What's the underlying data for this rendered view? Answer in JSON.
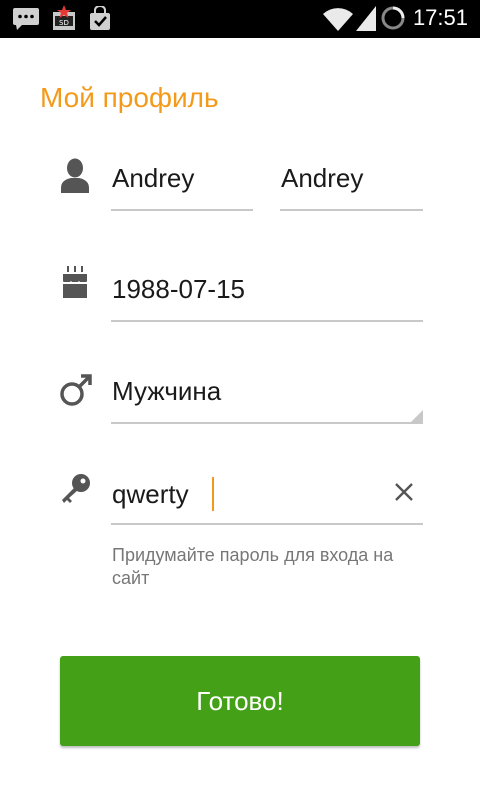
{
  "status_bar": {
    "time": "17:51",
    "sd_badge": "SD",
    "icons": [
      "chat-icon",
      "sd-card-icon",
      "bag-check-icon",
      "wifi-icon",
      "signal-icon",
      "loading-icon"
    ]
  },
  "profile": {
    "title": "Мой профиль",
    "first_name": "Andrey",
    "last_name": "Andrey",
    "birth_date": "1988-07-15",
    "gender": "Мужчина",
    "password": "qwerty",
    "password_hint": "Придумайте пароль для входа на сайт",
    "submit_label": "Готово!"
  },
  "colors": {
    "accent": "#f49a1a",
    "button": "#43a017",
    "icon": "#555555"
  }
}
